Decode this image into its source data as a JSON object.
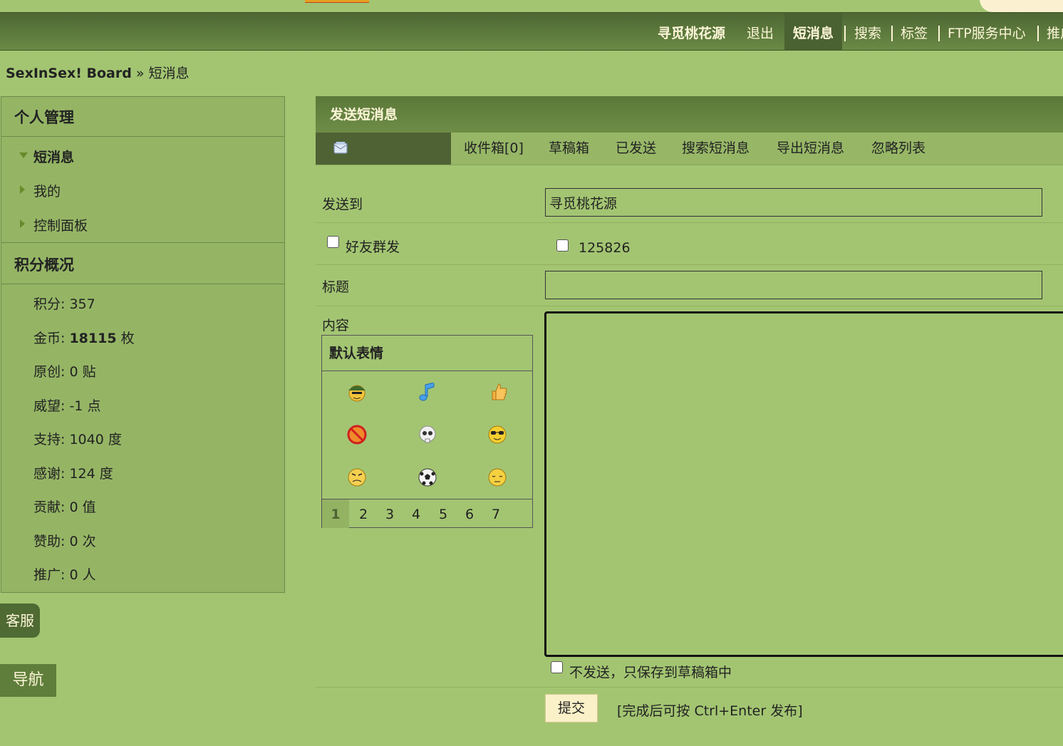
{
  "nav": {
    "username": "寻觅桃花源",
    "logout": "退出",
    "messages": "短消息",
    "search": "搜索",
    "tags": "标签",
    "ftp": "FTP服务中心",
    "more": "推广"
  },
  "breadcrumb": {
    "home": "SexInSex! Board",
    "separator": "»",
    "current": "短消息"
  },
  "sidebar": {
    "personal_header": "个人管理",
    "items": [
      "短消息",
      "我的",
      "控制面板"
    ],
    "points_header": "积分概况",
    "stats": [
      {
        "label": "积分:",
        "value": "357",
        "unit": ""
      },
      {
        "label": "金币:",
        "value": "18115",
        "unit": "枚"
      },
      {
        "label": "原创:",
        "value": "0",
        "unit": "贴"
      },
      {
        "label": "威望:",
        "value": "-1",
        "unit": "点"
      },
      {
        "label": "支持:",
        "value": "1040",
        "unit": "度"
      },
      {
        "label": "感谢:",
        "value": "124",
        "unit": "度"
      },
      {
        "label": "贡献:",
        "value": "0",
        "unit": "值"
      },
      {
        "label": "赞助:",
        "value": "0",
        "unit": "次"
      },
      {
        "label": "推广:",
        "value": "0",
        "unit": "人"
      }
    ],
    "kefu": "客服",
    "daohang": "导航"
  },
  "main": {
    "title": "发送短消息",
    "tabs": [
      "收件箱[0]",
      "草稿箱",
      "已发送",
      "搜索短消息",
      "导出短消息",
      "忽略列表"
    ],
    "icon": "envelope-icon"
  },
  "form": {
    "to_label": "发送到",
    "to_value": "寻觅桃花源",
    "group_label": "好友群发",
    "friend_id": "125826",
    "subject_label": "标题",
    "subject_value": "",
    "content_label": "内容",
    "smilies_header": "默认表情",
    "smilies_pages": [
      "1",
      "2",
      "3",
      "4",
      "5",
      "6",
      "7"
    ],
    "draft_label": "不发送，只保存到草稿箱中",
    "submit": "提交",
    "hint": "[完成后可按 Ctrl+Enter 发布]"
  },
  "colors": {
    "background": "#a3c572",
    "navbar": "#5a7a3a",
    "submit_bg": "#fbf1c8"
  }
}
